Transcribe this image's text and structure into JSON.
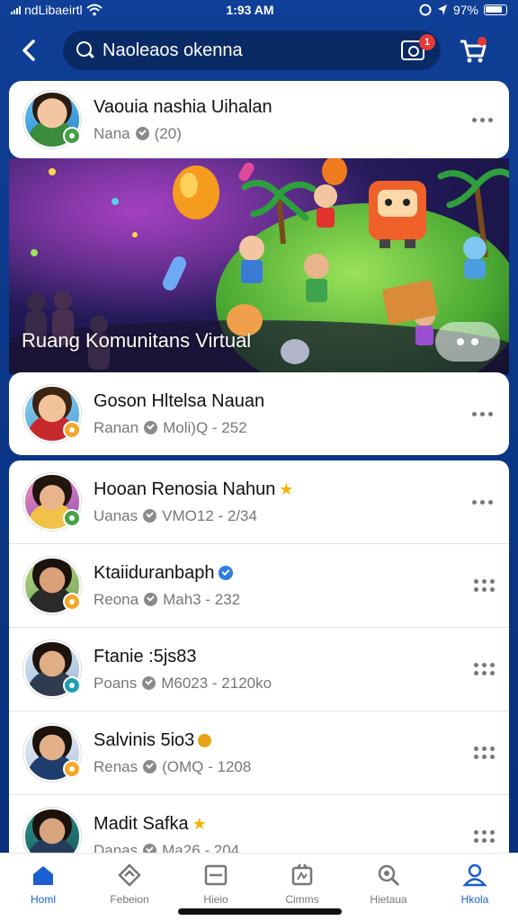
{
  "status_bar": {
    "carrier": "ndLibaeirtl",
    "time": "1:93 AM",
    "battery": "97%"
  },
  "header": {
    "search_text": "Naoleaos okenna",
    "notification_count": "1"
  },
  "top_user": {
    "name": "Vaouia nashia Uihalan",
    "meta": "Nana",
    "meta_count": "(20)"
  },
  "banner": {
    "title": "Ruang Komunitans Virtual"
  },
  "featured_user": {
    "name": "Goson Hltelsa Nauan",
    "meta": "Ranan",
    "meta_detail": "Moli)Q - 252"
  },
  "list": [
    {
      "name": "Hooan Renosia Nahun",
      "meta": "Uanas",
      "detail": "VMO12 - 2/34",
      "badge": "star"
    },
    {
      "name": "Ktaiiduranbaph",
      "meta": "Reona",
      "detail": "Mah3 - 232",
      "badge": "blue-check"
    },
    {
      "name": "Ftanie :5js83",
      "meta": "Poans",
      "detail": "M6023 - 2120ko",
      "badge": "none"
    },
    {
      "name": "Salvinis 5io3",
      "meta": "Renas",
      "detail": "(OMQ - 1208",
      "badge": "coin"
    },
    {
      "name": "Madit Safka",
      "meta": "Danas",
      "detail": "Ma26 - 204",
      "badge": "star"
    }
  ],
  "nav": {
    "items": [
      {
        "label": "Homl",
        "icon": "home-icon"
      },
      {
        "label": "Febeion",
        "icon": "feed-icon"
      },
      {
        "label": "Hieio",
        "icon": "card-icon"
      },
      {
        "label": "Cimms",
        "icon": "games-icon"
      },
      {
        "label": "Hietaua",
        "icon": "search-icon"
      },
      {
        "label": "Hkola",
        "icon": "profile-icon"
      }
    ]
  },
  "colors": {
    "background": "#0d3a8c",
    "accent": "#1a5fd0",
    "badge_green": "#43a047",
    "badge_orange": "#f5a623"
  }
}
